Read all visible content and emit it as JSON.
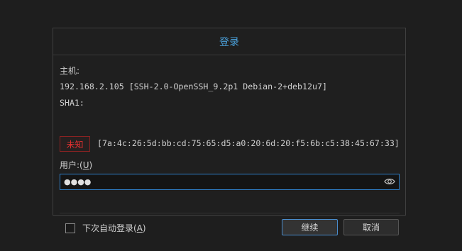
{
  "dialog": {
    "title": "登录",
    "host_label": "主机:",
    "host_value": "192.168.2.105 [SSH-2.0-OpenSSH_9.2p1 Debian-2+deb12u7]",
    "sha_label": "SHA1:",
    "trust_badge": "未知",
    "fingerprint": "[7a:4c:26:5d:bb:cd:75:65:d5:a0:20:6d:20:f5:6b:c5:38:45:67:33]",
    "user_label_prefix": "用户:(",
    "user_label_key": "U",
    "user_label_suffix": ")",
    "user_value": "●●●●",
    "remember_prefix": "下次自动登录(",
    "remember_key": "A",
    "remember_suffix": ")",
    "continue_label": "继续",
    "cancel_label": "取消",
    "colors": {
      "title": "#4a9fd8",
      "badge_text": "#e03030",
      "input_border": "#2f7fc8"
    }
  }
}
